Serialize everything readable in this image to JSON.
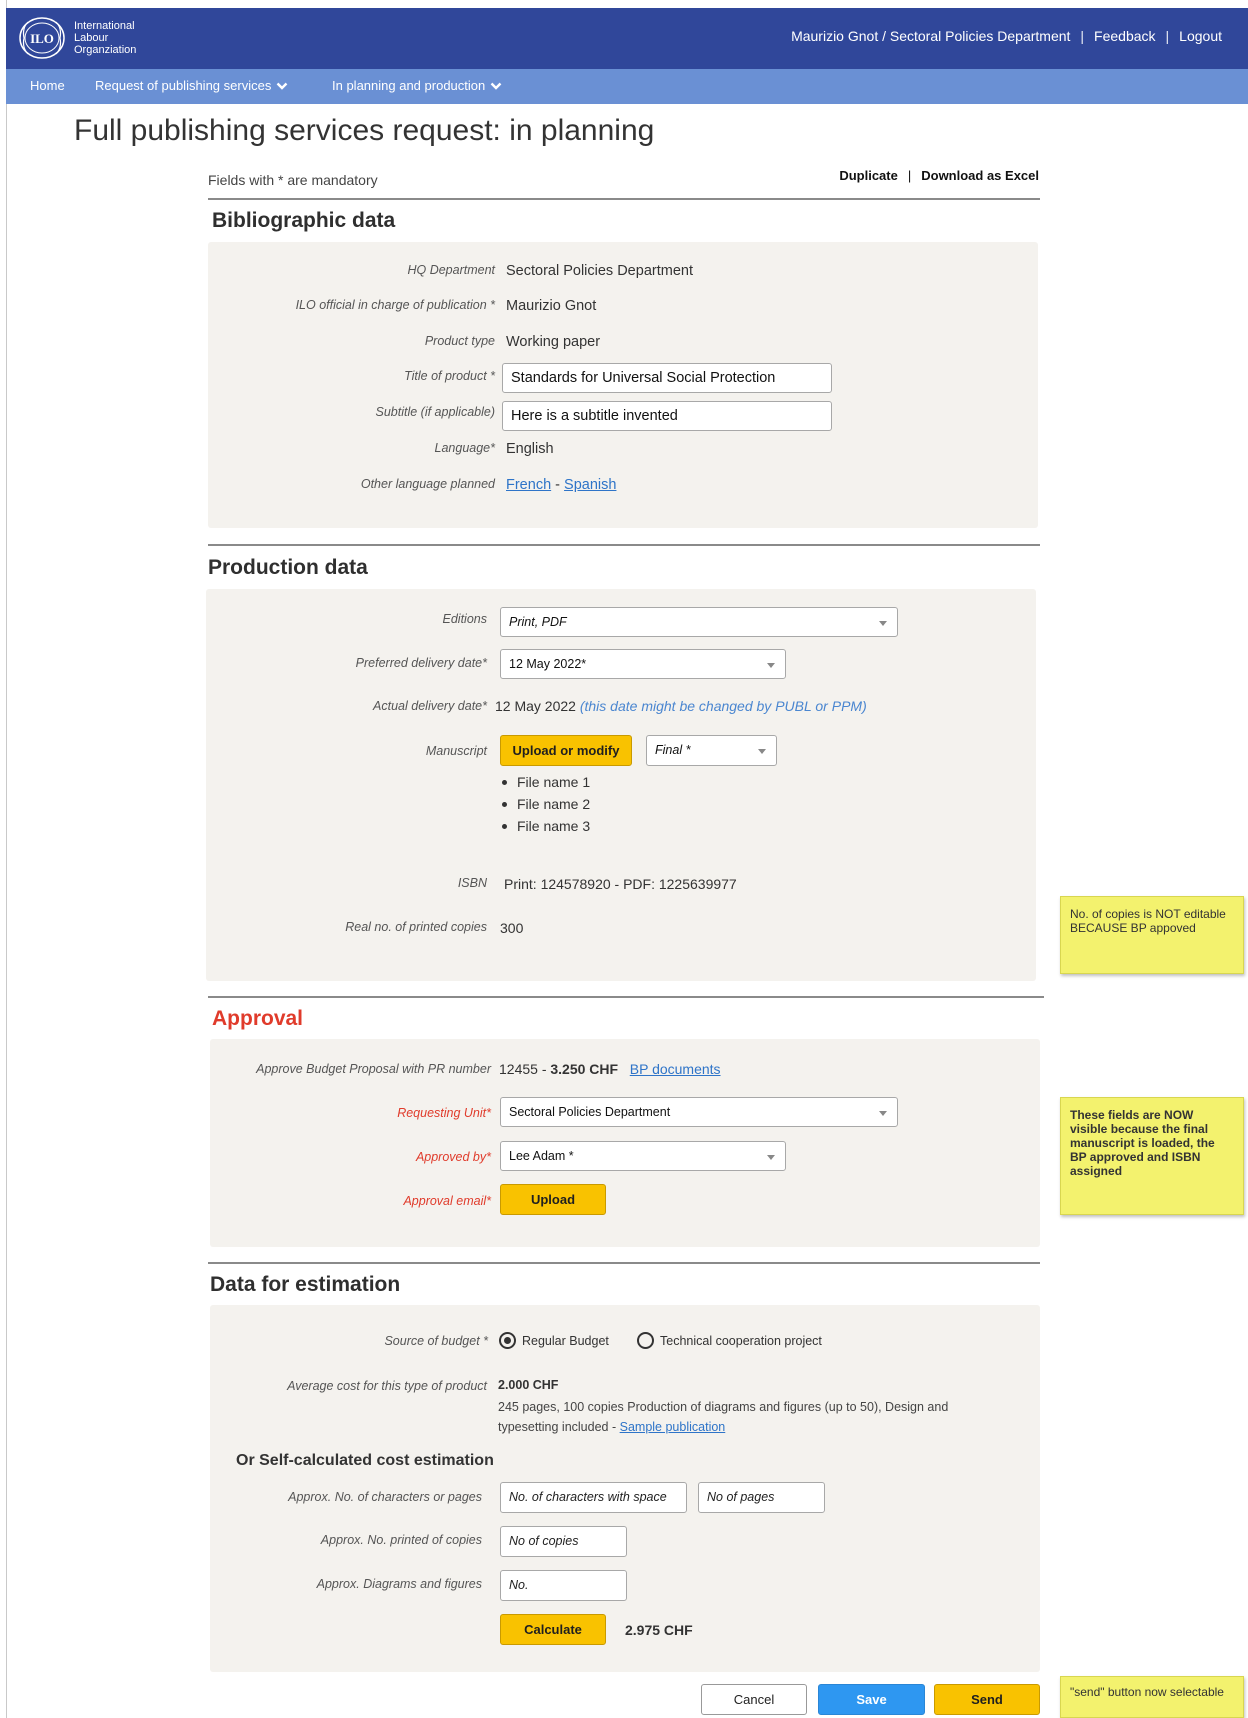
{
  "header": {
    "org_name": [
      "International",
      "Labour",
      "Organziation"
    ],
    "user": "Maurizio Gnot / Sectoral Policies Department",
    "feedback": "Feedback",
    "logout": "Logout",
    "separator": "|"
  },
  "nav": {
    "home": "Home",
    "request": "Request of publishing services",
    "planning": "In planning and production"
  },
  "page": {
    "title": "Full publishing services request: in planning",
    "mandatory_note": "Fields with * are mandatory",
    "duplicate": "Duplicate",
    "download": "Download as Excel"
  },
  "bibliographic": {
    "title": "Bibliographic data",
    "hq_department_label": "HQ Department",
    "hq_department": "Sectoral Policies Department",
    "official_label": "ILO official in charge of publication *",
    "official": "Maurizio Gnot",
    "product_type_label": "Product type",
    "product_type": "Working paper",
    "product_title_label": "Title of product *",
    "product_title": "Standards for Universal Social Protection",
    "subtitle_label": "Subtitle (if applicable)",
    "subtitle": "Here is a subtitle invented",
    "language_label": "Language*",
    "language": "English",
    "other_lang_label": "Other language planned",
    "other_lang_1": "French",
    "other_lang_sep": "-",
    "other_lang_2": "Spanish"
  },
  "production": {
    "title": "Production data",
    "editions_label": "Editions",
    "editions": "Print, PDF",
    "preferred_date_label": "Preferred delivery date*",
    "preferred_date": "12 May 2022*",
    "actual_date_label": "Actual delivery date*",
    "actual_date": "12 May 2022",
    "actual_date_hint": "(this date might be changed by PUBL or PPM)",
    "manuscript_label": "Manuscript",
    "upload_button": "Upload or modify",
    "manuscript_status": "Final *",
    "files": [
      "File name 1",
      "File name 2",
      "File name 3"
    ],
    "isbn_label": "ISBN",
    "isbn": "Print: 124578920 - PDF: 1225639977",
    "copies_label": "Real no. of printed copies",
    "copies": "300"
  },
  "approval": {
    "title": "Approval",
    "bp_label": "Approve Budget Proposal with PR number",
    "pr_number": "12455 -",
    "bp_amount": "3.250 CHF",
    "bp_docs": "BP documents",
    "requesting_unit_label": "Requesting Unit*",
    "requesting_unit": "Sectoral Policies Department",
    "approved_by_label": "Approved by*",
    "approved_by": "Lee Adam *",
    "approval_email_label": "Approval email*",
    "upload_button": "Upload"
  },
  "estimation": {
    "title": "Data for estimation",
    "source_label": "Source of budget *",
    "source_options": [
      "Regular Budget",
      "Technical cooperation  project"
    ],
    "source_selected": "Regular Budget",
    "avg_cost_label": "Average cost for this type of product",
    "avg_cost": "2.000 CHF",
    "avg_desc": "245 pages, 100 copies Production of diagrams and figures (up to 50), Design and typesetting included -",
    "sample_link": "Sample publication",
    "self_calc_title": "Or Self-calculated cost estimation",
    "chars_label": "Approx.  No. of characters or pages",
    "chars_placeholder": "No. of characters with space",
    "pages_placeholder": "No of pages",
    "copies_label": "Approx. No. printed of copies",
    "copies_placeholder": "No of copies",
    "diagrams_label": "Approx. Diagrams and figures",
    "diagrams_placeholder": "No.",
    "calculate_button": "Calculate",
    "result": "2.975 CHF"
  },
  "footer_buttons": {
    "cancel": "Cancel",
    "save": "Save",
    "send": "Send"
  },
  "notes": {
    "copies_note": "No. of copies  is NOT editable BECAUSE BP appoved",
    "fields_note": "These fields are NOW visible because the final manuscript is loaded, the BP approved and ISBN assigned",
    "send_note": "\"send\" button now selectable"
  },
  "colors": {
    "header_bg": "#30479a",
    "nav_bg": "#6a90d4",
    "accent_yellow": "#f9c200",
    "save_blue": "#2e97f1",
    "approval_red": "#e03b2b",
    "sticky_yellow": "#f3f26e"
  }
}
